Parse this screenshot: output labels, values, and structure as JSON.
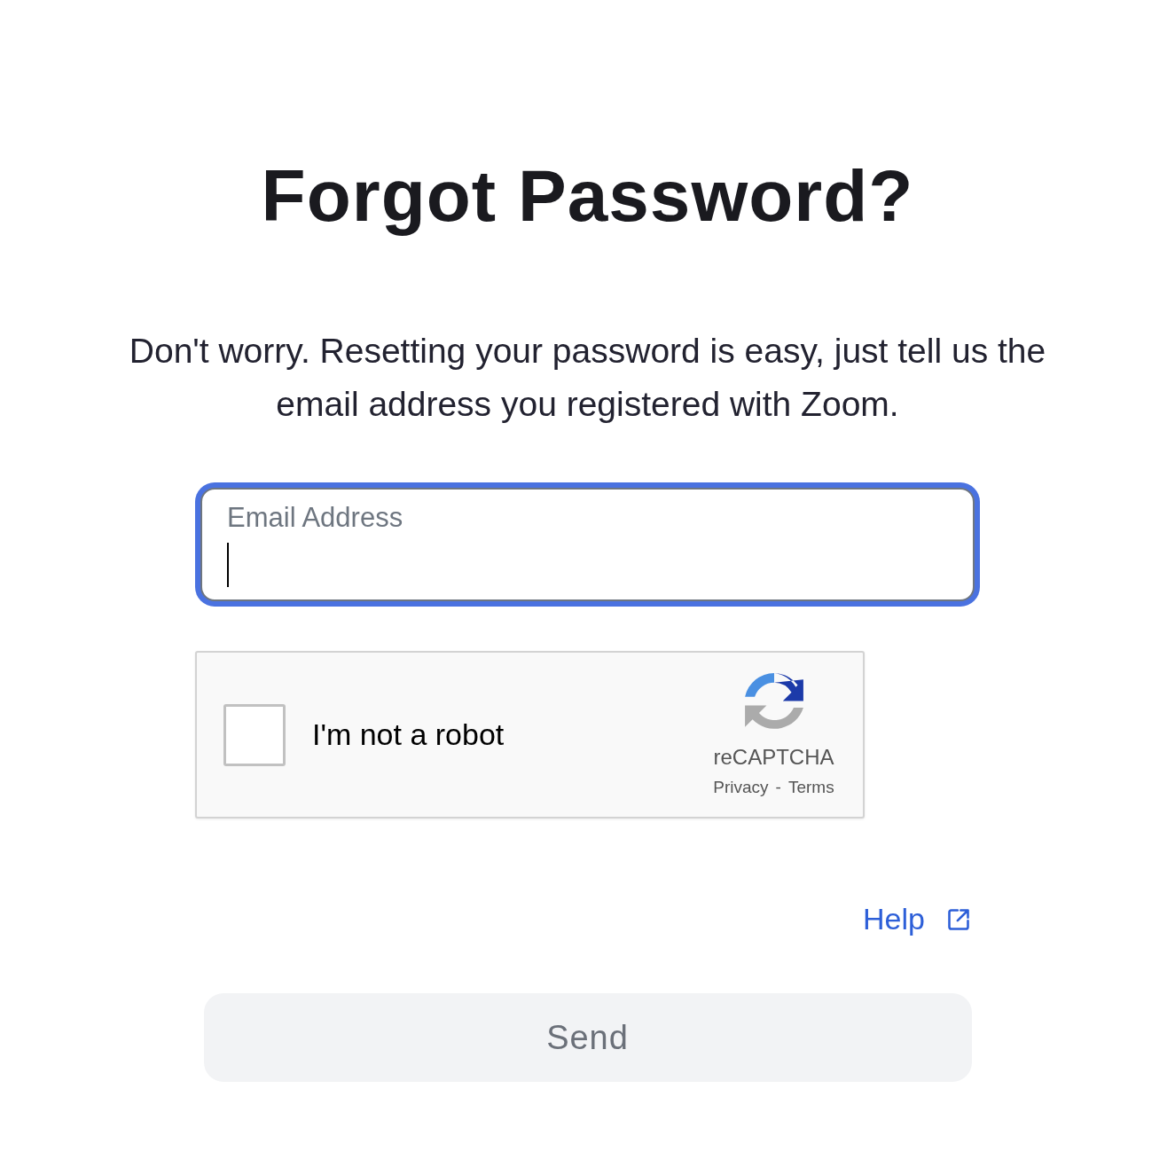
{
  "title": "Forgot Password?",
  "description": "Don't worry. Resetting your password is easy, just tell us the email address you registered with Zoom.",
  "email_field": {
    "label": "Email Address",
    "focused": true
  },
  "recaptcha": {
    "label": "I'm not a robot",
    "checked": false,
    "brand": "reCAPTCHA",
    "privacy": "Privacy",
    "separator": "-",
    "terms": "Terms"
  },
  "help_link": {
    "label": "Help"
  },
  "send_button": {
    "label": "Send",
    "disabled": true
  }
}
